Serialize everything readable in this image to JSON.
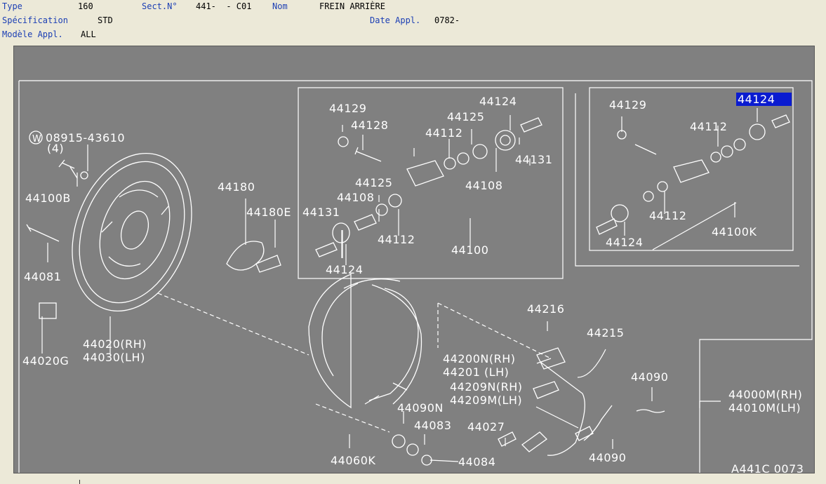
{
  "header": {
    "type_label": "Type",
    "type_value": "160",
    "sect_label": "Sect.N°",
    "sect_value": "441-  - C01",
    "nom_label": "Nom",
    "nom_value": "FREIN ARRIÈRE",
    "spec_label": "Spécification",
    "spec_value": "STD",
    "date_label": "Date Appl.",
    "date_value": "0782-",
    "model_label": "Modèle Appl.",
    "model_value": "ALL"
  },
  "diagram": {
    "selected_part": "44124",
    "drawing_code": "A441C 0073",
    "parts": {
      "p_08915": "08915-43610",
      "p_qty4": "(4)",
      "p_44100B": "44100B",
      "p_44081": "44081",
      "p_44020G": "44020G",
      "p_44020": "44020(RH)",
      "p_44030": "44030(LH)",
      "p_44180": "44180",
      "p_44180E": "44180E",
      "p_44129a": "44129",
      "p_44128": "44128",
      "p_44124a": "44124",
      "p_44125a": "44125",
      "p_44112a": "44112",
      "p_44131a": "44131",
      "p_44108a": "44108",
      "p_44125b": "44125",
      "p_44108b": "44108",
      "p_44131b": "44131",
      "p_44112b": "44112",
      "p_44124b": "44124",
      "p_44100": "44100",
      "p_44129b": "44129",
      "p_44112c": "44112",
      "p_44112d": "44112",
      "p_44124d": "44124",
      "p_44100K": "44100K",
      "p_44216": "44216",
      "p_44215": "44215",
      "p_44200N": "44200N(RH)",
      "p_44201": "44201  (LH)",
      "p_44209N": "44209N(RH)",
      "p_44209M": "44209M(LH)",
      "p_44090N": "44090N",
      "p_44083": "44083",
      "p_44027": "44027",
      "p_44084": "44084",
      "p_44060K": "44060K",
      "p_44090a": "44090",
      "p_44090b": "44090",
      "p_44000M": "44000M(RH)",
      "p_44010M": "44010M(LH)"
    }
  }
}
